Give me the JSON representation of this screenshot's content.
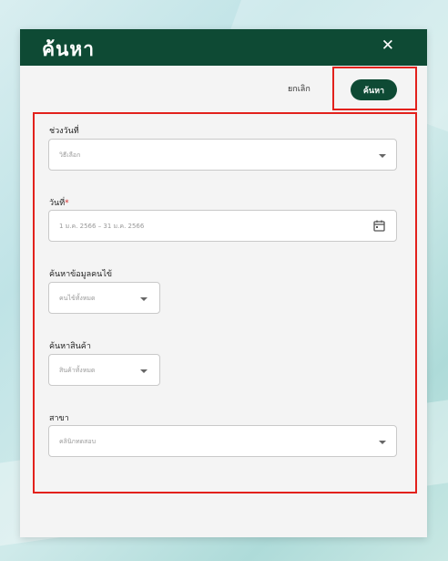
{
  "dialog": {
    "title": "ค้นหา",
    "close_glyph": "✕",
    "cancel_label": "ยกเลิก",
    "search_label": "ค้นหา"
  },
  "form": {
    "date_range": {
      "label": "ช่วงวันที่",
      "value": "วิธีเลือก"
    },
    "date": {
      "label": "วันที่",
      "required_mark": "*",
      "value": "1 ม.ค. 2566 – 31 ม.ค. 2566",
      "icon": "calendar-icon"
    },
    "patient": {
      "label": "ค้นหาข้อมูลคนไข้",
      "value": "คนไข้ทั้งหมด"
    },
    "product": {
      "label": "ค้นหาสินค้า",
      "value": "สินค้าทั้งหมด"
    },
    "branch": {
      "label": "สาขา",
      "value": "คลินิกทดสอบ"
    }
  },
  "colors": {
    "header": "#0e4a34",
    "highlight": "#e2211c",
    "required": "#d32f2f"
  }
}
